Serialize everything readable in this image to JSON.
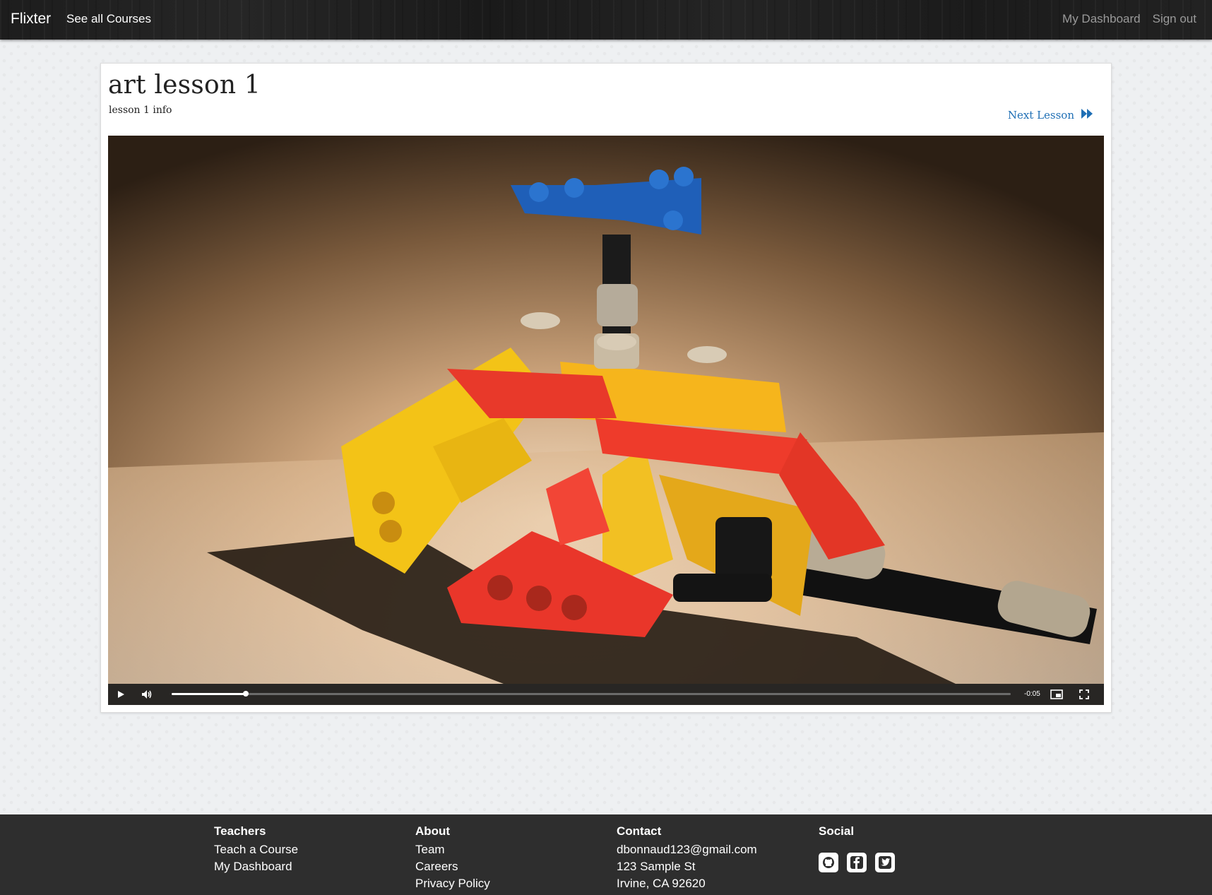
{
  "navbar": {
    "brand": "Flixter",
    "see_all_courses": "See all Courses",
    "my_dashboard": "My Dashboard",
    "sign_out": "Sign out"
  },
  "lesson": {
    "title": "art lesson 1",
    "info": "lesson 1 info",
    "next_lesson_label": "Next Lesson",
    "next_lesson_icon": "fast-forward-icon"
  },
  "video": {
    "time_remaining": "-0:05",
    "progress": 0.088,
    "controls": [
      "play-icon",
      "volume-icon",
      "picture-in-picture-icon",
      "fullscreen-icon"
    ]
  },
  "footer": {
    "teachers": {
      "heading": "Teachers",
      "links": [
        "Teach a Course",
        "My Dashboard"
      ]
    },
    "about": {
      "heading": "About",
      "links": [
        "Team",
        "Careers",
        "Privacy Policy"
      ]
    },
    "contact": {
      "heading": "Contact",
      "email": "dbonnaud123@gmail.com",
      "address_line1": "123 Sample St",
      "address_line2": "Irvine, CA 92620"
    },
    "social": {
      "heading": "Social",
      "icons": [
        "github-icon",
        "facebook-icon",
        "twitter-icon"
      ]
    }
  },
  "colors": {
    "navbar_bg": "#1f1f1f",
    "link_blue": "#1f6fb5",
    "footer_bg": "#2e2e2e",
    "page_bg": "#eef0f2"
  }
}
